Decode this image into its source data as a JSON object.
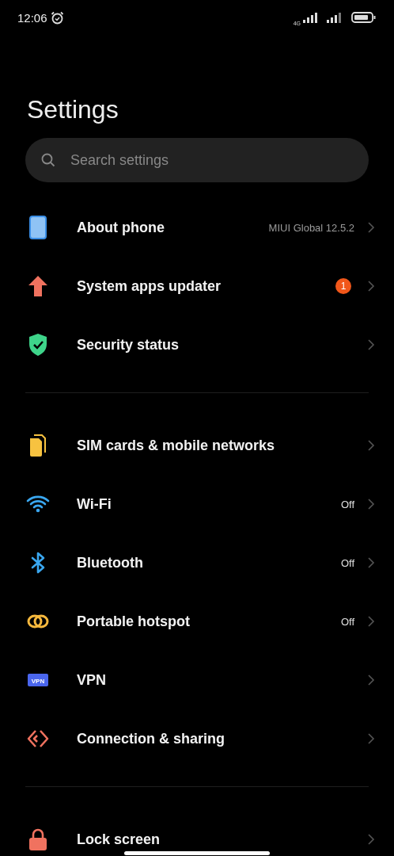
{
  "status_bar": {
    "time": "12:06",
    "network": "4G"
  },
  "title": "Settings",
  "search": {
    "placeholder": "Search settings"
  },
  "groups": [
    {
      "items": [
        {
          "kind": "phone",
          "label": "About phone",
          "value": "MIUI Global 12.5.2"
        },
        {
          "kind": "update",
          "label": "System apps updater",
          "badge": "1"
        },
        {
          "kind": "shield",
          "label": "Security status"
        }
      ]
    },
    {
      "items": [
        {
          "kind": "sim",
          "label": "SIM cards & mobile networks"
        },
        {
          "kind": "wifi",
          "label": "Wi-Fi",
          "value": "Off"
        },
        {
          "kind": "bluetooth",
          "label": "Bluetooth",
          "value": "Off"
        },
        {
          "kind": "hotspot",
          "label": "Portable hotspot",
          "value": "Off"
        },
        {
          "kind": "vpn",
          "label": "VPN",
          "icon_text": "VPN"
        },
        {
          "kind": "connection",
          "label": "Connection & sharing"
        }
      ]
    },
    {
      "items": [
        {
          "kind": "lock",
          "label": "Lock screen"
        }
      ]
    }
  ]
}
